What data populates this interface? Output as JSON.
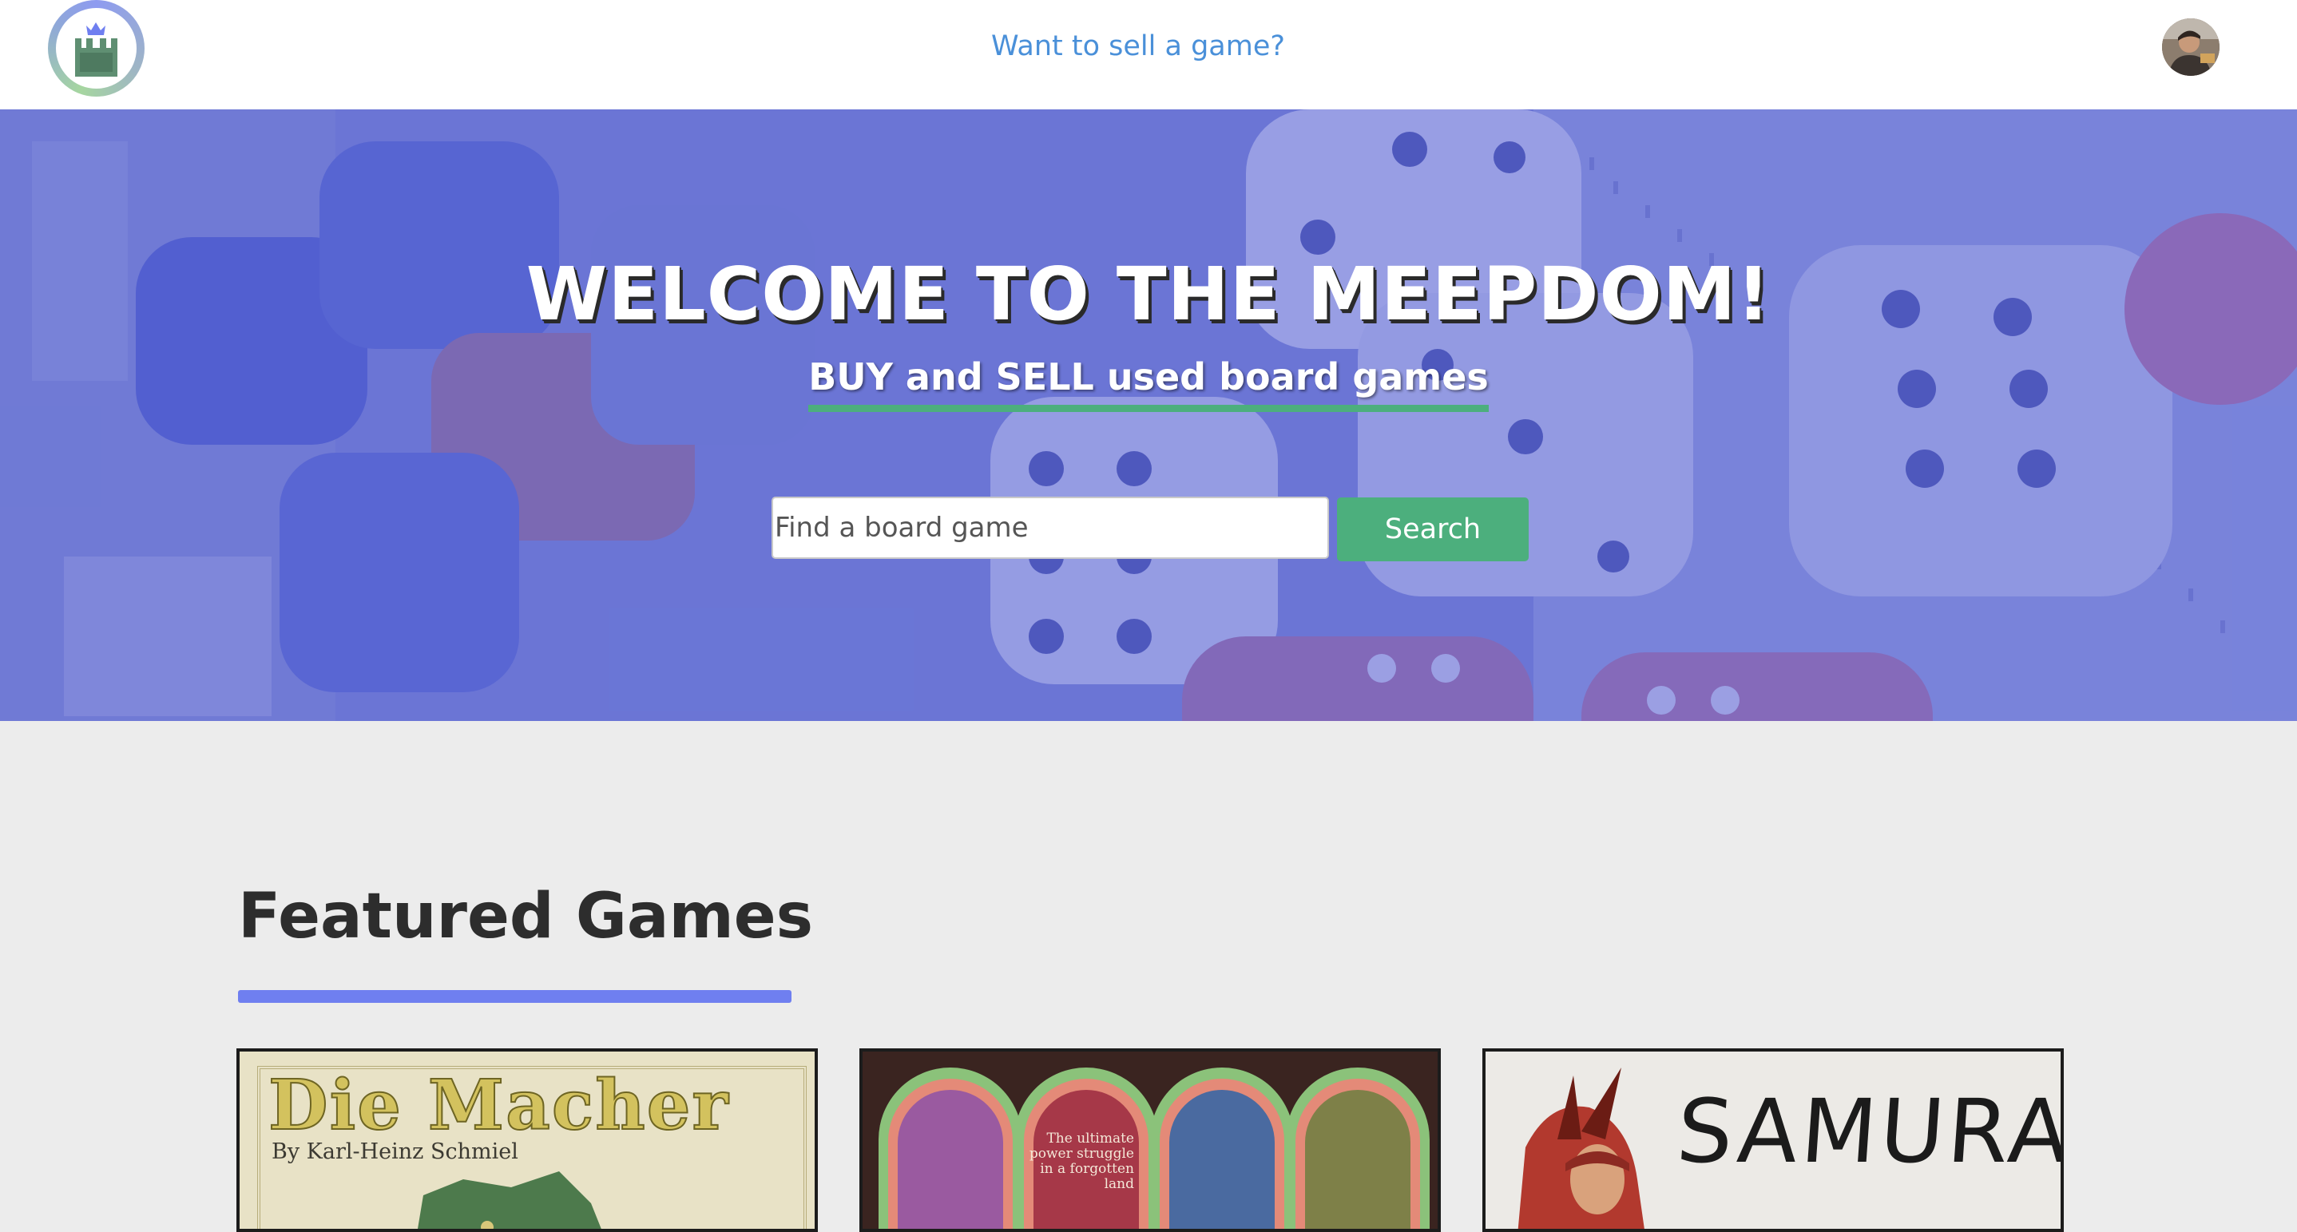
{
  "navbar": {
    "sell_link": "Want to sell a game?"
  },
  "hero": {
    "title": "WELCOME TO THE MEEPDOM!",
    "subtitle": "BUY and SELL used board games",
    "search": {
      "placeholder": "Find a board game",
      "button_label": "Search"
    }
  },
  "featured": {
    "title": "Featured Games",
    "games": [
      {
        "cover_title": "Die Macher",
        "cover_byline": "By Karl-Heinz Schmiel"
      },
      {
        "cover_tagline": "The ultimate power struggle in a forgotten land"
      },
      {
        "cover_title": "SAMURAI"
      }
    ]
  },
  "colors": {
    "accent_blue": "#6f7ff0",
    "accent_green": "#4caf7d",
    "link_blue": "#4a90d9",
    "background": "#ececec"
  },
  "icons": {
    "logo": "castle-crown-icon",
    "avatar": "user-avatar"
  }
}
